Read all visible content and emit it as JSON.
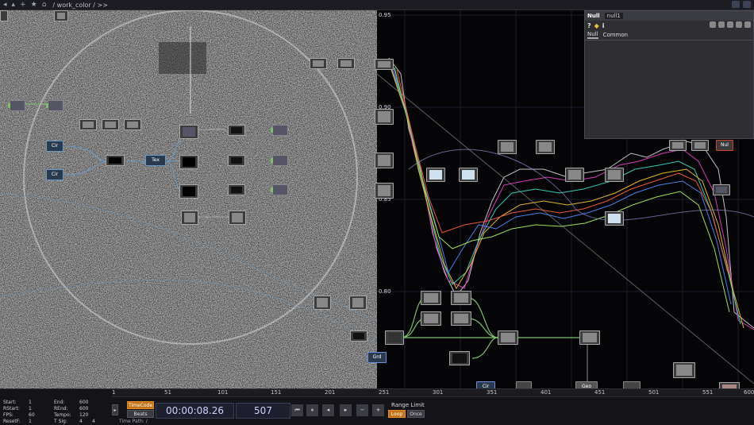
{
  "pathbar": {
    "path": "/ work_color / >>"
  },
  "graph": {
    "y_ticks": [
      "0.95",
      "0.90",
      "0.85",
      "0.80"
    ]
  },
  "panel": {
    "title": "Null",
    "node_name": "null1",
    "tabs": [
      "Null",
      "Common"
    ]
  },
  "nodes": {
    "circle1": "Cir",
    "circle2": "Cir",
    "text": "Tex",
    "grid": "Grd",
    "circle3": "Cir",
    "geo": "Geo",
    "null_right": "Nul"
  },
  "ruler": {
    "ticks": [
      "1",
      "51",
      "101",
      "151",
      "201",
      "251",
      "301",
      "351",
      "401",
      "451",
      "501",
      "551",
      "600"
    ],
    "graph_ticks": [
      "101",
      "201",
      "301",
      "401",
      "500"
    ]
  },
  "stats": {
    "start_label": "Start:",
    "start_value": "1",
    "rstart_label": "RStart:",
    "rstart_value": "1",
    "fps_label": "FPS:",
    "fps_value": "60",
    "resetf_label": "ResetF:",
    "resetf_value": "1",
    "end_label": "End:",
    "end_value": "600",
    "rend_label": "REnd:",
    "rend_value": "600",
    "tempo_label": "Tempo:",
    "tempo_value": "120",
    "tsig_label": "T Sig:",
    "tsig_value1": "4",
    "tsig_value2": "4"
  },
  "transport": {
    "timecode_btn": "TimeCode",
    "beats_btn": "Beats",
    "timecode": "00:00:08.26",
    "frame": "507",
    "range_limit": "Range Limit",
    "loop": "Loop",
    "once": "Once",
    "minus": "−",
    "plus": "+",
    "time_path": "Time Path: /"
  }
}
